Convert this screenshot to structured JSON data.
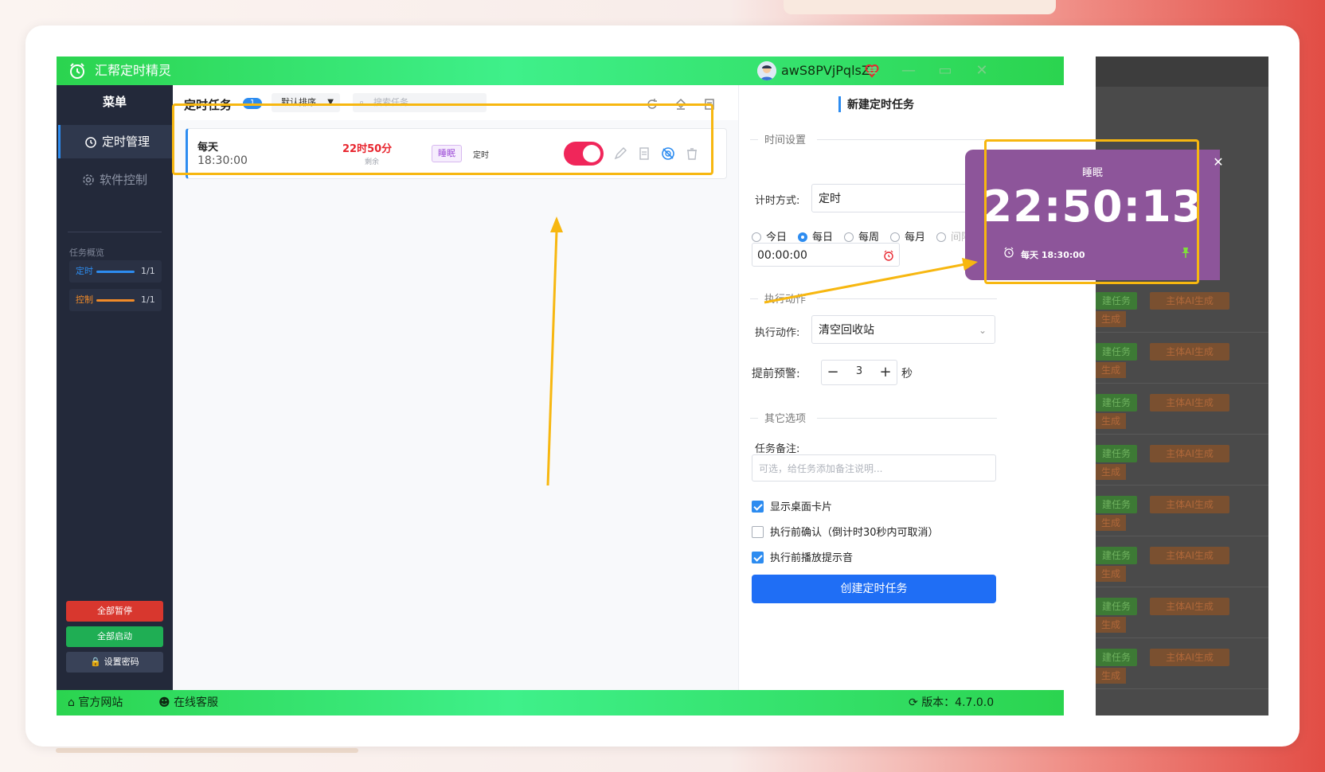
{
  "app": {
    "title": "汇帮定时精灵",
    "username": "awS8PVjPqlsZ"
  },
  "icons": {
    "app": "alarm-clock-icon",
    "vip": "heart-diamond-icon",
    "menu": "hamburger-icon",
    "minimize": "minimize-icon",
    "maximize": "maximize-icon",
    "close": "close-icon"
  },
  "colors": {
    "titlebar": "#2bd44f",
    "sidebar": "#23293a",
    "accent": "#2d8cf0",
    "primary": "#1f6ef5",
    "danger": "#e8262f",
    "toggle": "#f0265a",
    "popup": "#8d559a",
    "highlight": "#f7b710"
  },
  "window_controls": {
    "menu": "≡",
    "minimize": "—",
    "maximize": "▭",
    "close": "✕"
  },
  "sidebar": {
    "menu_title": "菜单",
    "items": [
      {
        "label": "定时管理",
        "icon": "clock-icon",
        "active": true
      },
      {
        "label": "软件控制",
        "icon": "gear-icon",
        "active": false
      }
    ],
    "overview_title": "任务概览",
    "overview": [
      {
        "label": "定时",
        "count": "1/1",
        "color": "#2d8cf0"
      },
      {
        "label": "控制",
        "count": "1/1",
        "color": "#f08a28"
      }
    ],
    "buttons": {
      "pause_all": "全部暂停",
      "start_all": "全部启动",
      "set_password": "🔒 设置密码"
    }
  },
  "task_list": {
    "title": "定时任务",
    "count": "1",
    "sort_label": "默认排序",
    "search_placeholder": "搜索任务...",
    "tasks": [
      {
        "name": "每天",
        "time": "18:30:00",
        "countdown": "22时50分",
        "remaining_label": "剩余",
        "tag": "睡眠",
        "type": "定时",
        "enabled": true
      }
    ]
  },
  "form": {
    "title": "新建定时任务",
    "section_time": "时间设置",
    "timing_mode_label": "计时方式:",
    "timing_mode_value": "定时",
    "repeat_options": [
      "今日",
      "每日",
      "每周",
      "每月",
      "间隔"
    ],
    "repeat_selected": "每日",
    "time_value": "00:00:00",
    "section_action": "执行动作",
    "action_label": "执行动作:",
    "action_value": "清空回收站",
    "warn_label": "提前预警:",
    "warn_value": "3",
    "warn_unit": "秒",
    "section_other": "其它选项",
    "notes_label": "任务备注:",
    "notes_placeholder": "可选，给任务添加备注说明...",
    "options": [
      {
        "label": "显示桌面卡片",
        "checked": true
      },
      {
        "label": "执行前确认（倒计时30秒内可取消）",
        "checked": false
      },
      {
        "label": "执行前播放提示音",
        "checked": true
      }
    ],
    "submit_label": "创建定时任务"
  },
  "popup_card": {
    "name": "睡眠",
    "countdown": "22:50:13",
    "schedule": "每天 18:30:00"
  },
  "statusbar": {
    "website": "官方网站",
    "support": "在线客服",
    "version": "版本：4.7.0.0"
  },
  "background_app": {
    "button_a": "建任务",
    "button_b": "主体AI生成",
    "button_c": "生成"
  }
}
